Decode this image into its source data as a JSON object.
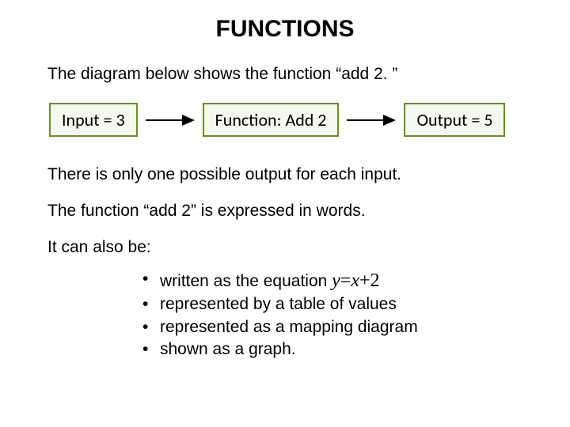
{
  "title": "FUNCTIONS",
  "intro": "The diagram below shows the function “add 2. ”",
  "diagram": {
    "input": "Input = 3",
    "function": "Function: Add 2",
    "output": "Output = 5"
  },
  "para1": "There is only one possible output for each input.",
  "para2": "The function “add 2” is expressed in words.",
  "lead": "It can also be:",
  "bullets": {
    "b1_prefix": "written as the equation ",
    "b1_eq_lhs": "y",
    "b1_eq_eq": "=",
    "b1_eq_rhs": "x",
    "b1_eq_op": "+",
    "b1_eq_num": "2",
    "b2": "represented by a table of values",
    "b3": "represented as a mapping diagram",
    "b4": "shown as a graph."
  }
}
